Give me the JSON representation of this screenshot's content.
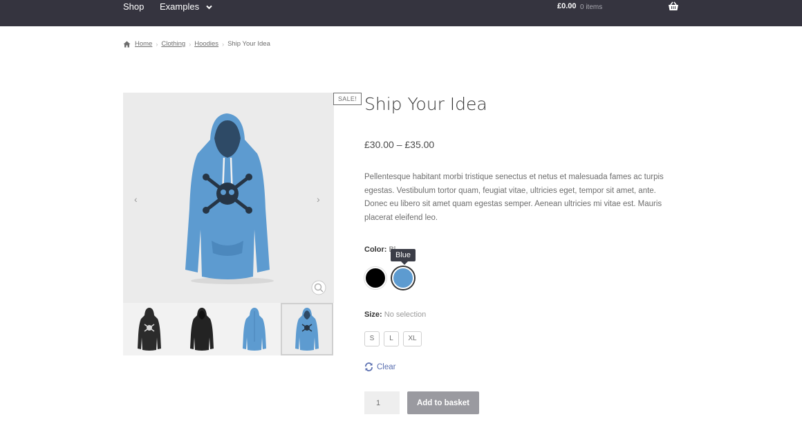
{
  "nav": {
    "items": [
      {
        "label": "Shop"
      },
      {
        "label": "Examples"
      }
    ],
    "cart": {
      "total": "£0.00",
      "count": "0 items"
    }
  },
  "breadcrumb": {
    "items": [
      "Home",
      "Clothing",
      "Hoodies"
    ],
    "current": "Ship Your Idea"
  },
  "gallery": {
    "sale_badge": "SALE!",
    "prev_arrow": "‹",
    "next_arrow": "›",
    "thumbnails": [
      {
        "color": "#2b2b2b"
      },
      {
        "color": "#232323"
      },
      {
        "color": "#5d9bd0"
      },
      {
        "color": "#5d9bd0"
      }
    ]
  },
  "product": {
    "title": "Ship Your Idea",
    "price": "£30.00 – £35.00",
    "description": "Pellentesque habitant morbi tristique senectus et netus et malesuada fames ac turpis egestas. Vestibulum tortor quam, feugiat vitae, ultricies eget, tempor sit amet, ante. Donec eu libero sit amet quam egestas semper. Aenean ultricies mi vitae est. Mauris placerat eleifend leo."
  },
  "variations": {
    "color_label": "Color:",
    "color_value": "Bl",
    "color_tooltip": "Blue",
    "colors": [
      "#000000",
      "#5d9bd0"
    ],
    "size_label": "Size:",
    "size_value": "No selection",
    "sizes": [
      "S",
      "L",
      "XL"
    ],
    "clear_label": "Clear"
  },
  "cart_form": {
    "quantity": "1",
    "add_button": "Add to basket"
  },
  "colors": {
    "topbar": "#35343f",
    "link": "#5a6fb0",
    "button": "#9a9aa0",
    "hoodie_blue": "#5d9bd0"
  }
}
